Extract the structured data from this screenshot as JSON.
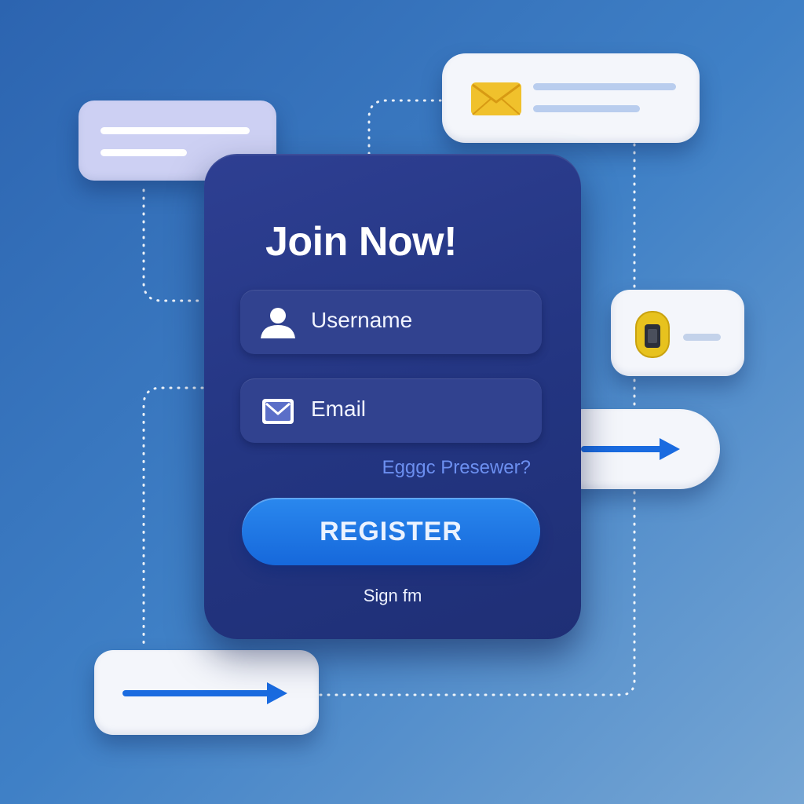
{
  "form": {
    "title": "Join Now!",
    "username_placeholder": "Username",
    "email_placeholder": "Email",
    "forgot_link": "Egggc Presewer?",
    "register_label": "REGISTER",
    "signin_link": "Sign fm"
  },
  "icons": {
    "username_field": "user-icon",
    "email_field": "envelope-icon",
    "mail_card": "mail-icon",
    "lock_card": "lock-icon",
    "arrow_cards": "arrow-right-icon"
  },
  "colors": {
    "background": "#3f80c6",
    "form_card": "#26378a",
    "field": "#31428f",
    "register_button": "#1e78e6",
    "forgot_link": "#6c8ff0",
    "card": "#f4f6fb",
    "message_card": "#cdd0f3",
    "mail_icon": "#f0c12c",
    "lock_icon": "#e7c21e",
    "arrow": "#1a6be0",
    "connector": "#ffffff"
  }
}
